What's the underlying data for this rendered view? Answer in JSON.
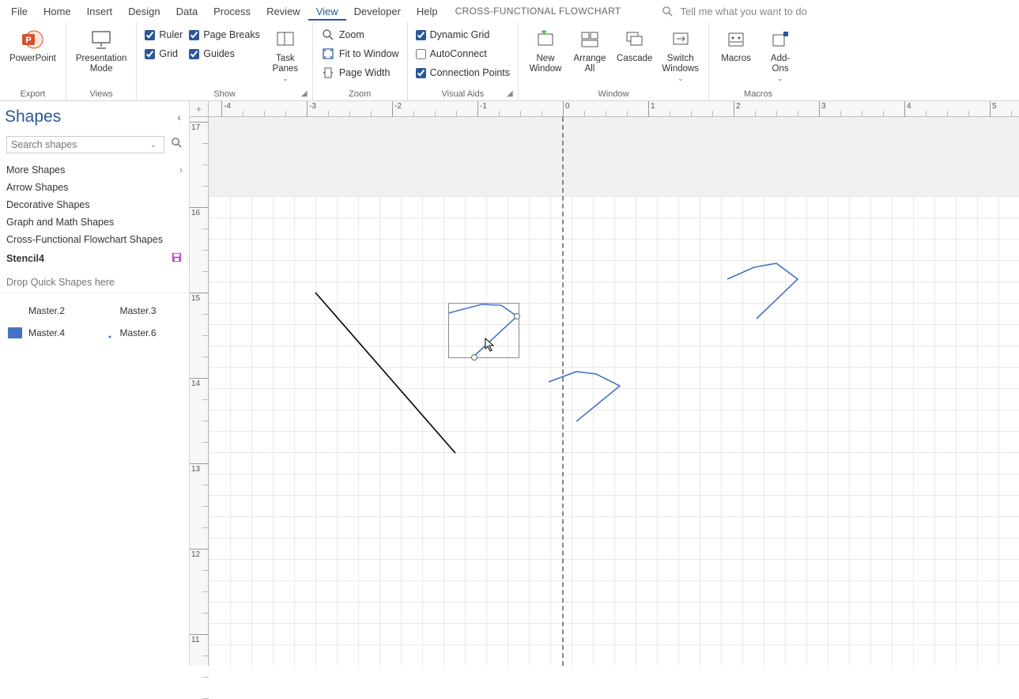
{
  "menu": {
    "items": [
      "File",
      "Home",
      "Insert",
      "Design",
      "Data",
      "Process",
      "Review",
      "View",
      "Developer",
      "Help"
    ],
    "active": "View",
    "template": "CROSS-FUNCTIONAL FLOWCHART",
    "tell_me": "Tell me what you want to do"
  },
  "ribbon": {
    "export": {
      "label": "Export",
      "powerpoint": "PowerPoint"
    },
    "views": {
      "label": "Views",
      "presentation": "Presentation\nMode"
    },
    "show": {
      "label": "Show",
      "ruler": "Ruler",
      "page_breaks": "Page Breaks",
      "grid": "Grid",
      "guides": "Guides",
      "task_panes": "Task\nPanes"
    },
    "zoom": {
      "label": "Zoom",
      "zoom": "Zoom",
      "fit": "Fit to Window",
      "page_width": "Page Width"
    },
    "visual_aids": {
      "label": "Visual Aids",
      "dynamic_grid": "Dynamic Grid",
      "autoconnect": "AutoConnect",
      "connection_points": "Connection Points"
    },
    "window": {
      "label": "Window",
      "new_window": "New\nWindow",
      "arrange_all": "Arrange\nAll",
      "cascade": "Cascade",
      "switch": "Switch\nWindows"
    },
    "macros": {
      "label": "Macros",
      "macros": "Macros",
      "addons": "Add-\nOns"
    }
  },
  "shapes": {
    "title": "Shapes",
    "search_placeholder": "Search shapes",
    "more": "More Shapes",
    "categories": [
      "Arrow Shapes",
      "Decorative Shapes",
      "Graph and Math Shapes",
      "Cross-Functional Flowchart Shapes"
    ],
    "stencil": "Stencil4",
    "drop_hint": "Drop Quick Shapes here",
    "masters": [
      "Master.2",
      "Master.3",
      "Master.4",
      "Master.6"
    ]
  },
  "ruler_h": [
    "-4",
    "-3",
    "-2",
    "-1",
    "0",
    "1",
    "2",
    "3",
    "4",
    "5"
  ],
  "ruler_v": [
    "17",
    "16",
    "15",
    "14",
    "13",
    "12",
    "11"
  ]
}
